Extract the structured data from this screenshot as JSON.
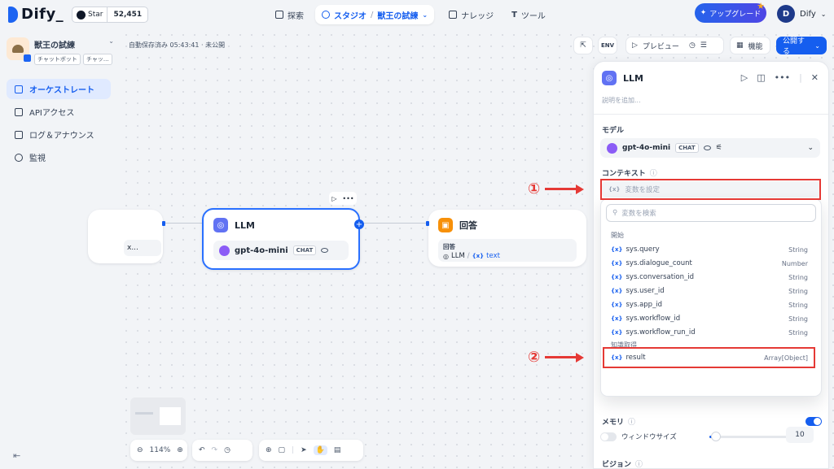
{
  "brand": {
    "name": "Dify_"
  },
  "github": {
    "label": "Star",
    "count": "52,451"
  },
  "nav": {
    "explore": "探索",
    "studio": "スタジオ",
    "current_app": "獣王の試練",
    "knowledge": "ナレッジ",
    "tools": "ツール"
  },
  "upgrade": {
    "label": "アップグレード"
  },
  "user": {
    "initial": "D",
    "name": "Dify"
  },
  "app": {
    "name": "獣王の試練",
    "tags": [
      "チャットボット",
      "チャッ..."
    ]
  },
  "sidebar": {
    "items": [
      {
        "label": "オーケストレート",
        "active": true
      },
      {
        "label": "APIアクセス"
      },
      {
        "label": "ログ＆アナウンス"
      },
      {
        "label": "監視"
      }
    ]
  },
  "canvas": {
    "autosave": "自動保存済み 05:43:41 · 未公開",
    "preview": "プレビュー",
    "features": "機能",
    "publish": "公開する",
    "zoom": "114%"
  },
  "nodes": {
    "prev": {
      "snippet": "x..."
    },
    "llm": {
      "title": "LLM",
      "model": "gpt-4o-mini",
      "chip": "CHAT"
    },
    "answer": {
      "title": "回答",
      "label": "回答",
      "ref_node": "LLM",
      "ref_var": "text"
    }
  },
  "panel": {
    "title": "LLM",
    "desc_placeholder": "説明を追加...",
    "model_label": "モデル",
    "model_name": "gpt-4o-mini",
    "model_chip": "CHAT",
    "context_label": "コンテキスト",
    "context_placeholder": "変数を設定",
    "search_placeholder": "変数を検索",
    "group_start": "開始",
    "group_knowledge": "知識取得",
    "vars": [
      {
        "name": "sys.query",
        "type": "String"
      },
      {
        "name": "sys.dialogue_count",
        "type": "Number"
      },
      {
        "name": "sys.conversation_id",
        "type": "String"
      },
      {
        "name": "sys.user_id",
        "type": "String"
      },
      {
        "name": "sys.app_id",
        "type": "String"
      },
      {
        "name": "sys.workflow_id",
        "type": "String"
      },
      {
        "name": "sys.workflow_run_id",
        "type": "String"
      }
    ],
    "result": {
      "name": "result",
      "type": "Array[Object]"
    },
    "memory_label": "メモリ",
    "window_label": "ウィンドウサイズ",
    "window_value": "10",
    "window_fraction": 0.08,
    "vision_label": "ビジョン"
  },
  "annotations": {
    "one": "①",
    "two": "②"
  },
  "colors": {
    "accent": "#155eef",
    "annotation": "#e53935"
  }
}
